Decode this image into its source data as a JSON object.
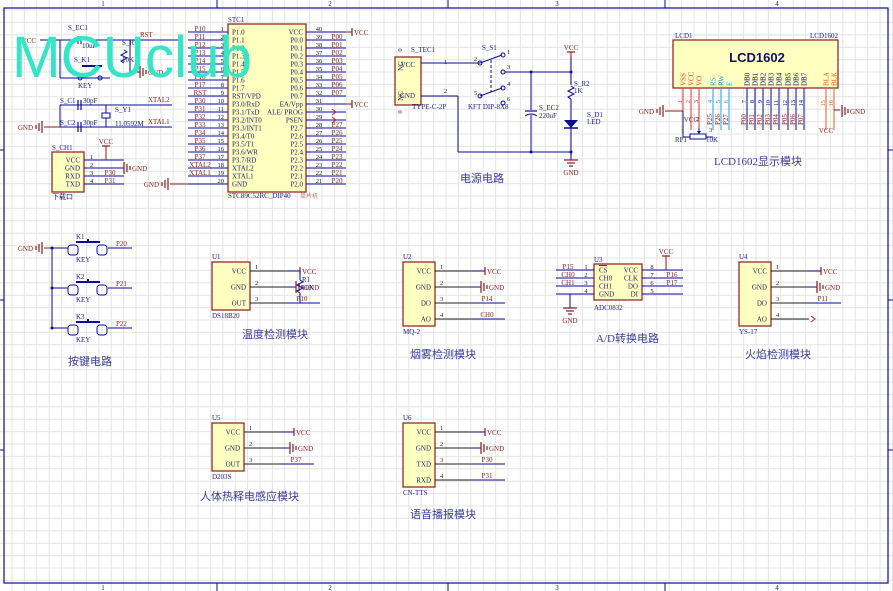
{
  "watermark": "MCUclub",
  "colors": {
    "wire": "#0a0a9a",
    "component_stroke": "#8b1a1a",
    "component_fill": "#ffffc0",
    "net_label": "#8b1a1a",
    "caption": "#3a3a9a",
    "watermark": "#35e6c6",
    "lcd_power_pins": "#e03030",
    "lcd_ctrl_pins": "#20a0d0",
    "lcd_backlight_pins": "#e06020",
    "grid": "#e4e4e4"
  },
  "zones": [
    "1",
    "2",
    "3",
    "4"
  ],
  "mcu": {
    "ref": "STC1",
    "part": "STC89C52RC_DIP40",
    "note": "单片机",
    "left_pins": [
      {
        "num": "1",
        "name": "P1.0",
        "net": "P10"
      },
      {
        "num": "2",
        "name": "P1.1",
        "net": "P11"
      },
      {
        "num": "3",
        "name": "P1.2",
        "net": "P12"
      },
      {
        "num": "4",
        "name": "P1.3",
        "net": "P13"
      },
      {
        "num": "5",
        "name": "P1.4",
        "net": "P14"
      },
      {
        "num": "6",
        "name": "P1.5",
        "net": "P15"
      },
      {
        "num": "7",
        "name": "P1.6",
        "net": "P16"
      },
      {
        "num": "8",
        "name": "P1.7",
        "net": "P17"
      },
      {
        "num": "9",
        "name": "RST/VPD",
        "net": "RST"
      },
      {
        "num": "10",
        "name": "P3.0/RxD",
        "net": "P30"
      },
      {
        "num": "11",
        "name": "P3.1/TxD",
        "net": "P31"
      },
      {
        "num": "12",
        "name": "P3.2/INT0",
        "net": "P32"
      },
      {
        "num": "13",
        "name": "P3.3/INT1",
        "net": "P33"
      },
      {
        "num": "14",
        "name": "P3.4/T0",
        "net": "P34"
      },
      {
        "num": "15",
        "name": "P3.5/T1",
        "net": "P35"
      },
      {
        "num": "16",
        "name": "P3.6/WR",
        "net": "P36"
      },
      {
        "num": "17",
        "name": "P3.7/RD",
        "net": "P37"
      },
      {
        "num": "18",
        "name": "XTAL2",
        "net": "XTAL2"
      },
      {
        "num": "19",
        "name": "XTAL1",
        "net": "XTAL1"
      },
      {
        "num": "20",
        "name": "GND",
        "net": "GND"
      }
    ],
    "right_pins": [
      {
        "num": "40",
        "name": "VCC",
        "net": "VCC"
      },
      {
        "num": "39",
        "name": "P0.0",
        "net": "P00"
      },
      {
        "num": "38",
        "name": "P0.1",
        "net": "P01"
      },
      {
        "num": "37",
        "name": "P0.2",
        "net": "P02"
      },
      {
        "num": "36",
        "name": "P0.3",
        "net": "P03"
      },
      {
        "num": "35",
        "name": "P0.4",
        "net": "P04"
      },
      {
        "num": "34",
        "name": "P0.5",
        "net": "P05"
      },
      {
        "num": "33",
        "name": "P0.6",
        "net": "P06"
      },
      {
        "num": "32",
        "name": "P0.7",
        "net": "P07"
      },
      {
        "num": "31",
        "name": "EA/Vpp",
        "net": "VCC"
      },
      {
        "num": "30",
        "name": "ALE/ PROG",
        "net": ""
      },
      {
        "num": "29",
        "name": "PSEN",
        "net": ""
      },
      {
        "num": "28",
        "name": "P2.7",
        "net": "P27"
      },
      {
        "num": "27",
        "name": "P2.6",
        "net": "P26"
      },
      {
        "num": "26",
        "name": "P2.5",
        "net": "P25"
      },
      {
        "num": "25",
        "name": "P2.4",
        "net": "P24"
      },
      {
        "num": "24",
        "name": "P2.3",
        "net": "P23"
      },
      {
        "num": "23",
        "name": "P2.2",
        "net": "P22"
      },
      {
        "num": "22",
        "name": "P2.1",
        "net": "P21"
      },
      {
        "num": "21",
        "name": "P2.0",
        "net": "P20"
      }
    ]
  },
  "reset": {
    "cap_ref": "S_EC1",
    "cap_val": "10uF",
    "res_ref": "S_R1",
    "res_val": "10K",
    "key_ref": "S_K1",
    "key_val": "KEY",
    "net_rst": "RST",
    "net_vcc": "VCC",
    "net_gnd": "GND"
  },
  "crystal": {
    "c1_ref": "S_C1",
    "c1_val": "30pF",
    "c2_ref": "S_C2",
    "c2_val": "30pF",
    "y_ref": "S_Y1",
    "y_val": "11.0592M",
    "net_x2": "XTAL2",
    "net_x1": "XTAL1",
    "net_gnd": "GND"
  },
  "download": {
    "ref": "S_CH1",
    "caption": "下载口",
    "net_vcc": "VCC",
    "pins": [
      {
        "num": "1",
        "name": "VCC",
        "net": ""
      },
      {
        "num": "2",
        "name": "GND",
        "net": "GND"
      },
      {
        "num": "3",
        "name": "RXD",
        "net": "P30"
      },
      {
        "num": "4",
        "name": "TXD",
        "net": "P31"
      }
    ]
  },
  "mcu_gnd": "GND",
  "power": {
    "conn_ref": "S_TEC1",
    "conn_part": "TYPE-C-2P",
    "conn_pins": [
      "VCC",
      "GND"
    ],
    "conn_nc": [
      "NC",
      "NC"
    ],
    "conn_pin_nums": [
      "1",
      "2"
    ],
    "conn_zero": [
      "0",
      "0"
    ],
    "sw_ref": "S_S1",
    "sw_part": "KFT DIP-8X8",
    "sw_pins": [
      "1",
      "2",
      "3",
      "4",
      "5",
      "6"
    ],
    "net_vcc": "VCC",
    "r_ref": "S_R2",
    "r_val": "1K",
    "cap_ref": "S_EC2",
    "cap_val": "220uF",
    "led_ref": "S_D1",
    "led_val": "LED",
    "net_gnd": "GND",
    "caption": "电源电路"
  },
  "lcd": {
    "ref": "LCD1",
    "part": "LCD1602",
    "title": "LCD1602",
    "pins": [
      {
        "num": "1",
        "name": "VSS",
        "net": "",
        "group": "power"
      },
      {
        "num": "2",
        "name": "VCC",
        "net": "",
        "group": "power"
      },
      {
        "num": "3",
        "name": "VO",
        "net": "",
        "group": "power"
      },
      {
        "num": "4",
        "name": "RS",
        "net": "P25",
        "group": "ctrl"
      },
      {
        "num": "5",
        "name": "RW",
        "net": "P26",
        "group": "ctrl"
      },
      {
        "num": "6",
        "name": "E",
        "net": "P27",
        "group": "ctrl"
      },
      {
        "num": "7",
        "name": "DB0",
        "net": "P00",
        "group": "data"
      },
      {
        "num": "8",
        "name": "DB1",
        "net": "P01",
        "group": "data"
      },
      {
        "num": "9",
        "name": "DB2",
        "net": "P02",
        "group": "data"
      },
      {
        "num": "10",
        "name": "DB3",
        "net": "P03",
        "group": "data"
      },
      {
        "num": "11",
        "name": "DB4",
        "net": "P04",
        "group": "data"
      },
      {
        "num": "12",
        "name": "DB5",
        "net": "P05",
        "group": "data"
      },
      {
        "num": "13",
        "name": "DB6",
        "net": "P06",
        "group": "data"
      },
      {
        "num": "14",
        "name": "DB7",
        "net": "P07",
        "group": "data"
      },
      {
        "num": "15",
        "name": "BLA",
        "net": "",
        "group": "backlight"
      },
      {
        "num": "16",
        "name": "BLK",
        "net": "",
        "group": "backlight"
      }
    ],
    "net_gnd_left": "GND",
    "net_vcc_left": "VCC",
    "rp_ref": "RP1",
    "rp_val": "10K",
    "rp_pins": [
      "1",
      "2",
      "3"
    ],
    "net_vcc_bla": "VCC",
    "net_gnd_blk": "GND",
    "caption": "LCD1602显示模块"
  },
  "keys": {
    "net_gnd": "GND",
    "items": [
      {
        "ref": "K1",
        "val": "KEY",
        "net": "P20"
      },
      {
        "ref": "K2",
        "val": "KEY",
        "net": "P21"
      },
      {
        "ref": "K3",
        "val": "KEY",
        "net": "P22"
      }
    ],
    "caption": "按键电路"
  },
  "adc": {
    "ref": "U3",
    "part": "ADC0832",
    "net_vcc": "VCC",
    "net_gnd": "GND",
    "left_pins": [
      {
        "num": "1",
        "name": "CS",
        "net": "P15"
      },
      {
        "num": "2",
        "name": "CH0",
        "net": "CH0"
      },
      {
        "num": "3",
        "name": "CH1",
        "net": "CH1"
      },
      {
        "num": "4",
        "name": "GND",
        "net": ""
      }
    ],
    "right_pins": [
      {
        "num": "8",
        "name": "VCC",
        "net": ""
      },
      {
        "num": "7",
        "name": "CLK",
        "net": "P16"
      },
      {
        "num": "6",
        "name": "DO",
        "net": "P17"
      },
      {
        "num": "5",
        "name": "DI",
        "net": ""
      }
    ],
    "caption": "A/D转换电路"
  },
  "modules": [
    {
      "id": "temp",
      "ref": "U1",
      "part": "DS18B20",
      "extra_ref": "R1",
      "extra_val": "10K",
      "caption": "温度检测模块",
      "pins": [
        {
          "num": "1",
          "name": "VCC",
          "net": "VCC"
        },
        {
          "num": "2",
          "name": "GND",
          "net": "GND"
        },
        {
          "num": "3",
          "name": "OUT",
          "net": "P10"
        }
      ]
    },
    {
      "id": "smoke",
      "ref": "U2",
      "part": "MQ-2",
      "caption": "烟雾检测模块",
      "pins": [
        {
          "num": "1",
          "name": "VCC",
          "net": "VCC"
        },
        {
          "num": "2",
          "name": "GND",
          "net": "GND"
        },
        {
          "num": "3",
          "name": "DO",
          "net": "P14"
        },
        {
          "num": "4",
          "name": "AO",
          "net": "CH0"
        }
      ]
    },
    {
      "id": "flame",
      "ref": "U4",
      "part": "YS-17",
      "caption": "火焰检测模块",
      "pins": [
        {
          "num": "1",
          "name": "VCC",
          "net": "VCC"
        },
        {
          "num": "2",
          "name": "GND",
          "net": "GND"
        },
        {
          "num": "3",
          "name": "DO",
          "net": "P11"
        },
        {
          "num": "4",
          "name": "AO",
          "net": ""
        }
      ]
    },
    {
      "id": "pir",
      "ref": "U5",
      "part": "D203S",
      "caption": "人体热释电感应模块",
      "pins": [
        {
          "num": "1",
          "name": "VCC",
          "net": "VCC"
        },
        {
          "num": "2",
          "name": "GND",
          "net": "GND"
        },
        {
          "num": "3",
          "name": "OUT",
          "net": "P37"
        }
      ]
    },
    {
      "id": "voice",
      "ref": "U6",
      "part": "CN-TTS",
      "caption": "语音播报模块",
      "pins": [
        {
          "num": "1",
          "name": "VCC",
          "net": "VCC"
        },
        {
          "num": "2",
          "name": "GND",
          "net": "GND"
        },
        {
          "num": "3",
          "name": "TXD",
          "net": "P30"
        },
        {
          "num": "4",
          "name": "RXD",
          "net": "P31"
        }
      ]
    }
  ]
}
